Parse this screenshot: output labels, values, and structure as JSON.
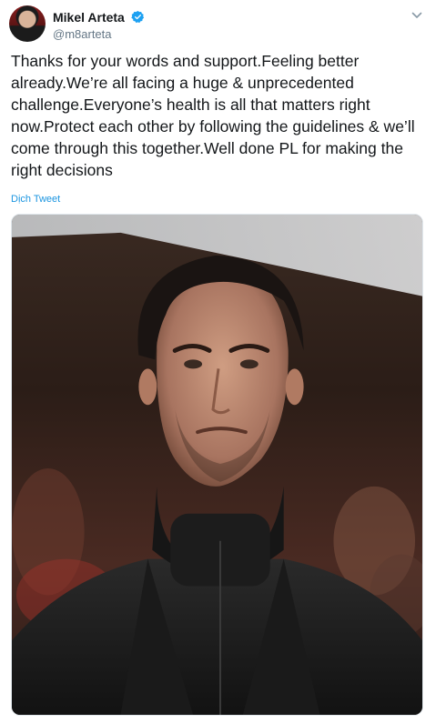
{
  "tweet": {
    "author": {
      "display_name": "Mikel Arteta",
      "handle": "@m8arteta",
      "verified": true
    },
    "text": "Thanks for your words and support.Feeling better already.We’re all facing a huge & unprecedented challenge.Everyone’s health is all that matters right now.Protect each other by following the guidelines & we’ll come through this together.Well done PL for making the right decisions",
    "translate_label": "Dịch Tweet",
    "media": {
      "type": "photo",
      "icon": "photo-of-man-in-dark-coat"
    }
  },
  "colors": {
    "text": "#14171a",
    "secondary_text": "#657786",
    "link": "#1b95e0",
    "verified_badge": "#1da1f2"
  }
}
